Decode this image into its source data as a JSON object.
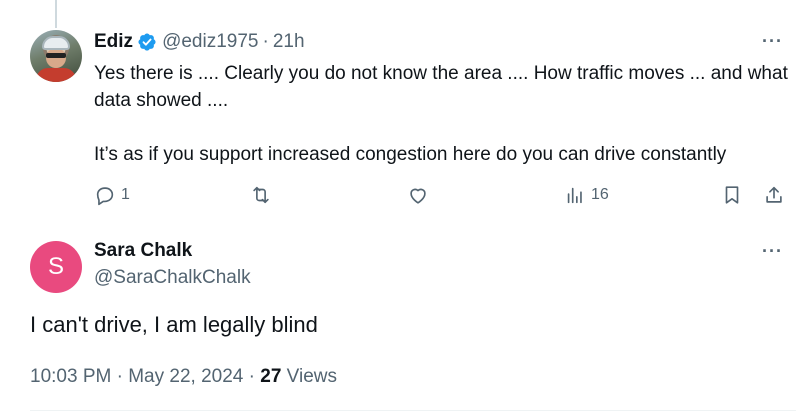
{
  "reply": {
    "author_name": "Ediz",
    "handle": "@ediz1975",
    "separator": "·",
    "time": "21h",
    "text_line1": "Yes there is .... Clearly you do not know the area .... How traffic moves ... and what data showed ....",
    "text_line2": "It’s as if you support increased congestion here do you can drive constantly",
    "reply_count": "1",
    "views_count": "16",
    "more_label": "···",
    "verified_color": "#1d9bf0"
  },
  "main": {
    "avatar_initial": "S",
    "avatar_color": "#e94a7f",
    "author_name": "Sara Chalk",
    "handle": "@SaraChalkChalk",
    "text": "I can't drive, I am legally blind",
    "time": "10:03 PM",
    "separator1": "·",
    "date": "May 22, 2024",
    "separator2": "·",
    "views_count": "27",
    "views_label": "Views",
    "more_label": "···"
  }
}
